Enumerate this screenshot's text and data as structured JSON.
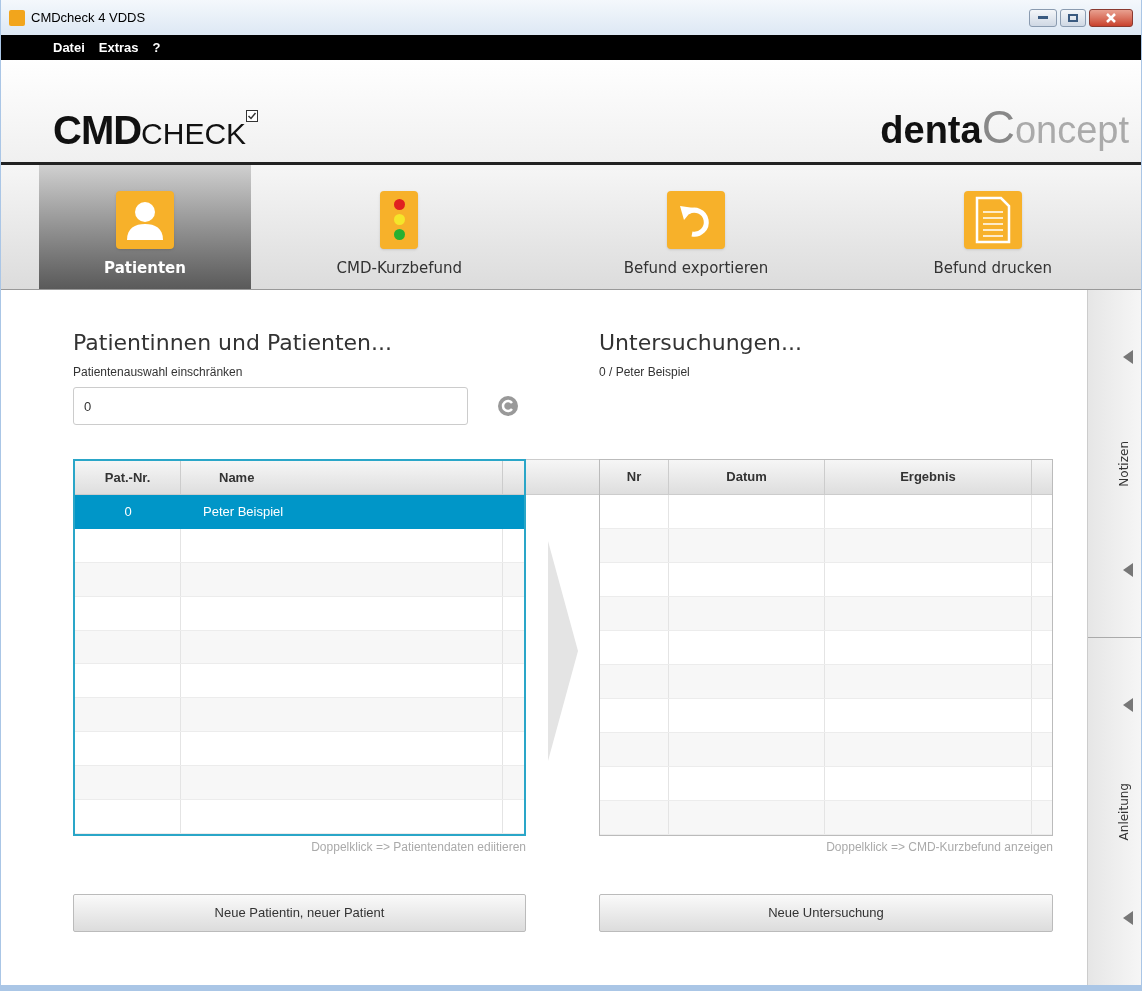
{
  "window": {
    "title": "CMDcheck 4 VDDS"
  },
  "menu": [
    {
      "label": "Datei"
    },
    {
      "label": "Extras"
    },
    {
      "label": "?"
    }
  ],
  "logo": {
    "bold": "CMD",
    "light": "CHECK",
    "partner_bold": "denta",
    "partner_c": "C",
    "partner_light": "oncept"
  },
  "toolbar": [
    {
      "label": "Patienten",
      "kind": "person",
      "selected": true
    },
    {
      "label": "CMD-Kurzbefund",
      "kind": "traffic-light",
      "selected": false
    },
    {
      "label": "Befund exportieren",
      "kind": "undo",
      "selected": false
    },
    {
      "label": "Befund drucken",
      "kind": "document",
      "selected": false
    }
  ],
  "patients": {
    "heading": "Patientinnen und Patienten...",
    "filter_label": "Patientenauswahl einschränken",
    "filter_value": "0",
    "columns": [
      "Pat.-Nr.",
      "Name"
    ],
    "rows": [
      {
        "nr": "0",
        "name": "Peter Beispiel",
        "selected": true
      }
    ],
    "hint": "Doppelklick => Patientendaten ediitieren",
    "button": "Neue Patientin, neuer Patient"
  },
  "exams": {
    "heading": "Untersuchungen...",
    "subtitle": "0 / Peter Beispiel",
    "columns": [
      "Nr",
      "Datum",
      "Ergebnis"
    ],
    "hint": "Doppelklick => CMD-Kurzbefund anzeigen",
    "button": "Neue Untersuchung"
  },
  "side_panels": [
    {
      "label": "Notizen"
    },
    {
      "label": "Anleitung"
    }
  ]
}
